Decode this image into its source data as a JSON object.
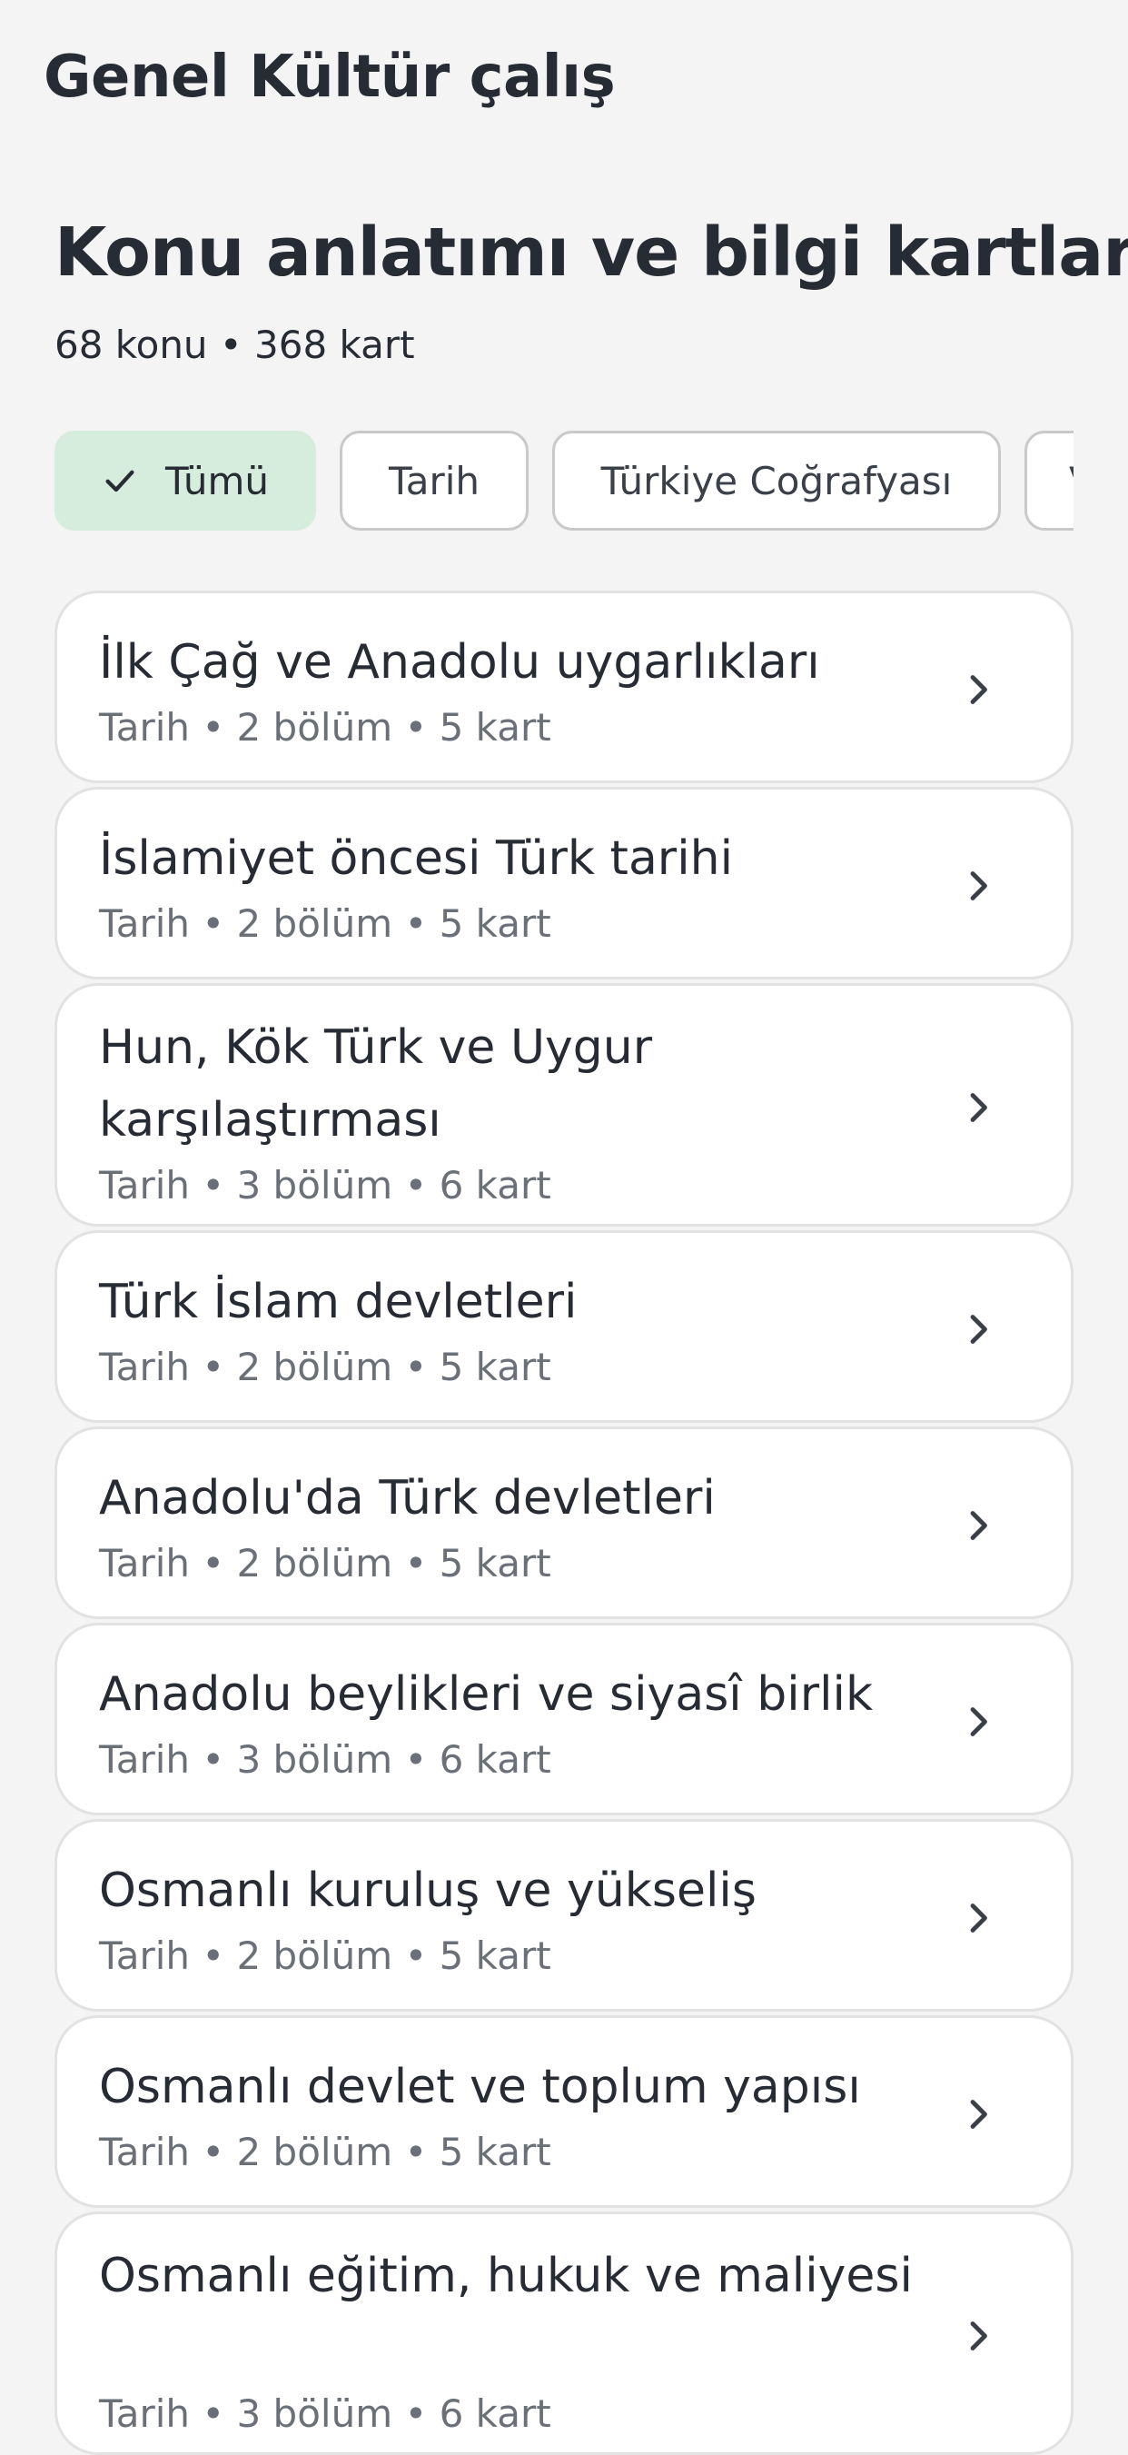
{
  "app": {
    "title": "Genel Kültür çalış"
  },
  "page": {
    "title": "Konu anlatımı ve bilgi kartları",
    "subtitle": "68 konu • 368 kart"
  },
  "filters": {
    "items": [
      {
        "label": "Tümü",
        "selected": true
      },
      {
        "label": "Tarih",
        "selected": false
      },
      {
        "label": "Türkiye Coğrafyası",
        "selected": false
      },
      {
        "label": "V",
        "selected": false
      }
    ]
  },
  "topics": [
    {
      "title": "İlk Çağ ve Anadolu uygarlıkları",
      "meta": "Tarih • 2 bölüm • 5 kart"
    },
    {
      "title": "İslamiyet öncesi Türk tarihi",
      "meta": "Tarih • 2 bölüm • 5 kart"
    },
    {
      "title": "Hun, Kök Türk ve Uygur karşılaştırması",
      "meta": "Tarih • 3 bölüm • 6 kart"
    },
    {
      "title": "Türk İslam devletleri",
      "meta": "Tarih • 2 bölüm • 5 kart"
    },
    {
      "title": "Anadolu'da Türk devletleri",
      "meta": "Tarih • 2 bölüm • 5 kart"
    },
    {
      "title": "Anadolu beylikleri ve siyasî birlik",
      "meta": "Tarih • 3 bölüm • 6 kart"
    },
    {
      "title": "Osmanlı kuruluş ve yükseliş",
      "meta": "Tarih • 2 bölüm • 5 kart"
    },
    {
      "title": "Osmanlı devlet ve toplum yapısı",
      "meta": "Tarih • 2 bölüm • 5 kart"
    },
    {
      "title": "Osmanlı eğitim, hukuk ve maliyesi",
      "meta": "Tarih • 3 bölüm • 6 kart"
    }
  ],
  "colors": {
    "background": "#f4f4f4",
    "selected_chip": "#d6ecdc",
    "text_primary": "#272b33",
    "text_secondary": "#6a6f78",
    "border": "#e2e2e2"
  },
  "icons": {
    "selected_chip": "check-icon",
    "card_action": "chevron-right-icon"
  }
}
